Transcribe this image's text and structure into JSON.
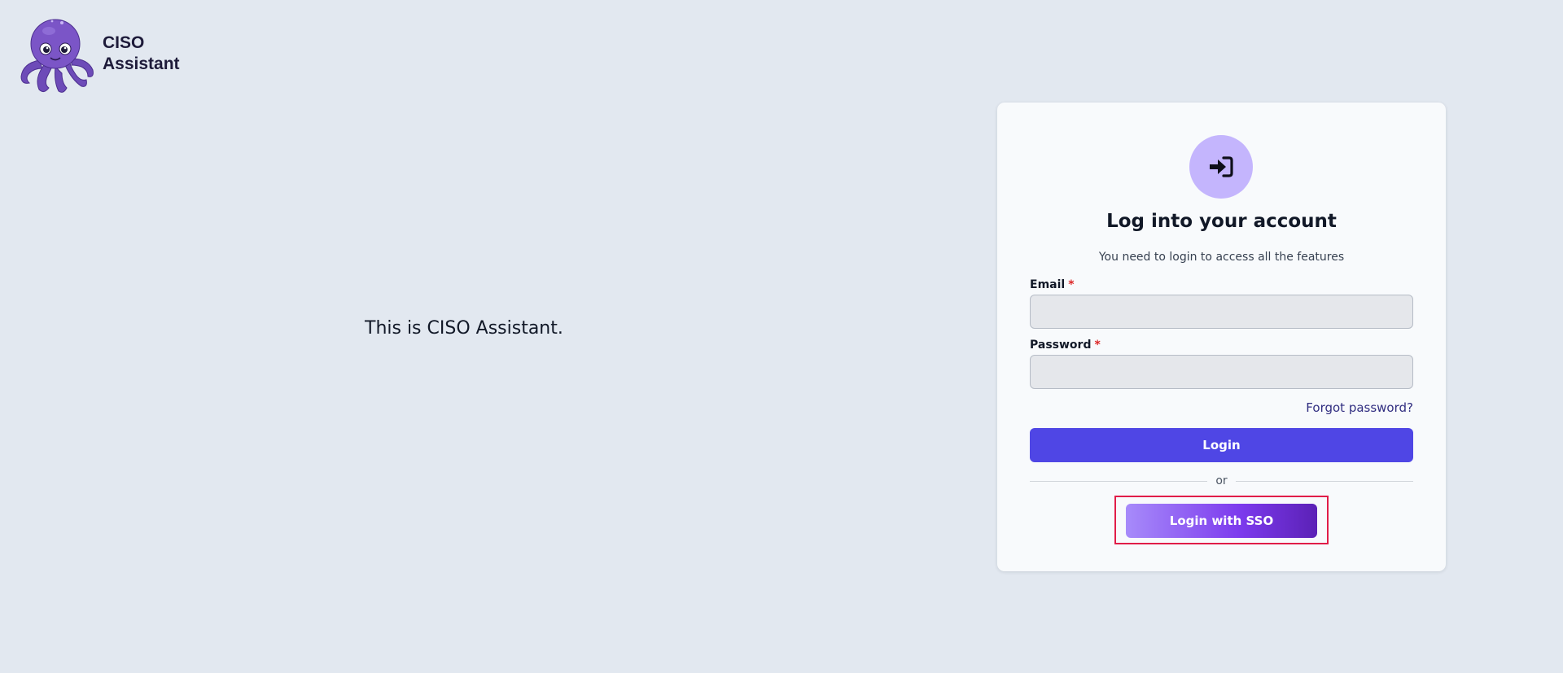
{
  "brand": {
    "line1": "CISO",
    "line2": "Assistant",
    "logo_icon": "octopus-mascot-icon"
  },
  "tagline": "This is CISO Assistant.",
  "login_card": {
    "icon": "sign-in-arrow-icon",
    "title": "Log into your account",
    "subtitle": "You need to login to access all the features",
    "email": {
      "label": "Email",
      "required_mark": "*",
      "value": "",
      "placeholder": ""
    },
    "password": {
      "label": "Password",
      "required_mark": "*",
      "value": "",
      "placeholder": ""
    },
    "forgot_password": "Forgot password?",
    "login_button": "Login",
    "divider_text": "or",
    "sso_button": "Login with SSO"
  },
  "colors": {
    "background": "#e2e8f0",
    "card": "#f8fafc",
    "primary": "#4f46e5",
    "icon_circle": "#c4b5fd",
    "sso_gradient_start": "#a78bfa",
    "sso_gradient_end": "#5b21b6",
    "highlight_frame": "#e11d48"
  }
}
